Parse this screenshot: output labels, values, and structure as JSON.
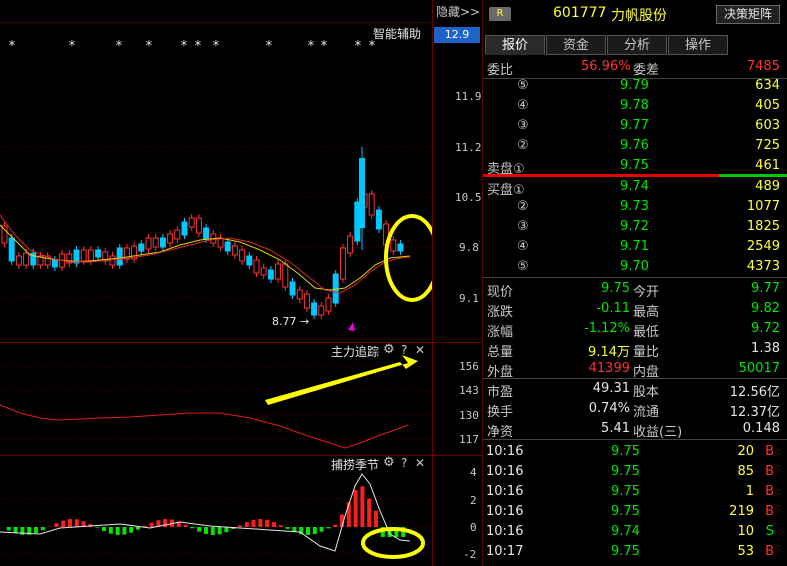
{
  "chart": {
    "hide_btn": "隐藏>>",
    "assist_label": "智能辅助",
    "top_price": "12.9",
    "price_axis": [
      "11.9",
      "11.2",
      "10.5",
      "9.8",
      "9.1"
    ],
    "low_marker": "8.77",
    "indicator1": {
      "name": "主力追踪",
      "axis": [
        "156",
        "143",
        "130",
        "117"
      ]
    },
    "indicator2": {
      "name": "捕捞季节",
      "axis": [
        "4",
        "2",
        "0",
        "-2"
      ]
    },
    "gear": "⚙",
    "help": "?",
    "close": "✕"
  },
  "header": {
    "badge": "R",
    "code": "601777",
    "name": "力帆股份",
    "matrix_btn": "决策矩阵"
  },
  "tabs": [
    "报价",
    "资金",
    "分析",
    "操作"
  ],
  "weibi": {
    "label": "委比",
    "value": "56.96%",
    "diff_label": "委差",
    "diff": "7485"
  },
  "sell": [
    {
      "level": "⑤",
      "price": "9.79",
      "vol": "634"
    },
    {
      "level": "④",
      "price": "9.78",
      "vol": "405"
    },
    {
      "level": "③",
      "price": "9.77",
      "vol": "603"
    },
    {
      "level": "②",
      "price": "9.76",
      "vol": "725"
    },
    {
      "level": "卖盘①",
      "price": "9.75",
      "vol": "461"
    }
  ],
  "buy": [
    {
      "level": "买盘①",
      "price": "9.74",
      "vol": "489"
    },
    {
      "level": "②",
      "price": "9.73",
      "vol": "1077"
    },
    {
      "level": "③",
      "price": "9.72",
      "vol": "1825"
    },
    {
      "level": "④",
      "price": "9.71",
      "vol": "2549"
    },
    {
      "level": "⑤",
      "price": "9.70",
      "vol": "4373"
    }
  ],
  "stats": [
    {
      "l1": "现价",
      "v1": "9.75",
      "c1": "c-green",
      "l2": "今开",
      "v2": "9.77",
      "c2": "c-green"
    },
    {
      "l1": "涨跌",
      "v1": "-0.11",
      "c1": "c-green",
      "l2": "最高",
      "v2": "9.82",
      "c2": "c-green"
    },
    {
      "l1": "涨幅",
      "v1": "-1.12%",
      "c1": "c-green",
      "l2": "最低",
      "v2": "9.72",
      "c2": "c-green"
    },
    {
      "l1": "总量",
      "v1": "9.14万",
      "c1": "c-yellow",
      "l2": "量比",
      "v2": "1.38",
      "c2": "c-white"
    },
    {
      "l1": "外盘",
      "v1": "41399",
      "c1": "c-red",
      "l2": "内盘",
      "v2": "50017",
      "c2": "c-green"
    }
  ],
  "fin": [
    {
      "l1": "市盈",
      "v1": "49.31",
      "l2": "股本",
      "v2": "12.56亿"
    },
    {
      "l1": "换手",
      "v1": "0.74%",
      "l2": "流通",
      "v2": "12.37亿"
    },
    {
      "l1": "净资",
      "v1": "5.41",
      "l2": "收益(三)",
      "v2": "0.148"
    }
  ],
  "ticks": [
    {
      "time": "10:16",
      "price": "9.75",
      "vol": "20",
      "side": "B"
    },
    {
      "time": "10:16",
      "price": "9.75",
      "vol": "85",
      "side": "B"
    },
    {
      "time": "10:16",
      "price": "9.75",
      "vol": "1",
      "side": "B"
    },
    {
      "time": "10:16",
      "price": "9.75",
      "vol": "219",
      "side": "B"
    },
    {
      "time": "10:16",
      "price": "9.74",
      "vol": "10",
      "side": "S"
    },
    {
      "time": "10:17",
      "price": "9.75",
      "vol": "53",
      "side": "B"
    }
  ]
}
